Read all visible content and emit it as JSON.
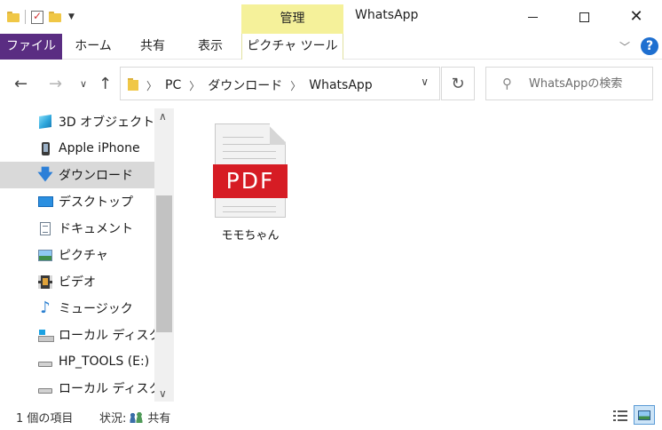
{
  "window": {
    "contextual_group": "管理",
    "title": "WhatsApp"
  },
  "ribbon": {
    "tabs": [
      {
        "label": "ファイル"
      },
      {
        "label": "ホーム"
      },
      {
        "label": "共有"
      },
      {
        "label": "表示"
      },
      {
        "label": "ピクチャ ツール"
      }
    ],
    "help_label": "?"
  },
  "address": {
    "crumbs": [
      "PC",
      "ダウンロード",
      "WhatsApp"
    ]
  },
  "search": {
    "placeholder": "WhatsAppの検索"
  },
  "sidebar": {
    "items": [
      {
        "label": "3D オブジェクト",
        "icon": "cube-3d-icon"
      },
      {
        "label": "Apple iPhone",
        "icon": "phone-icon"
      },
      {
        "label": "ダウンロード",
        "icon": "download-arrow-icon",
        "selected": true
      },
      {
        "label": "デスクトップ",
        "icon": "desktop-icon"
      },
      {
        "label": "ドキュメント",
        "icon": "document-icon"
      },
      {
        "label": "ピクチャ",
        "icon": "picture-icon"
      },
      {
        "label": "ビデオ",
        "icon": "video-icon"
      },
      {
        "label": "ミュージック",
        "icon": "music-note-icon"
      },
      {
        "label": "ローカル ディスク (C",
        "icon": "windows-drive-icon"
      },
      {
        "label": "HP_TOOLS (E:)",
        "icon": "drive-icon"
      },
      {
        "label": "ローカル ディスク (G",
        "icon": "drive-icon"
      }
    ]
  },
  "files": [
    {
      "name": "モモちゃん",
      "badge": "PDF",
      "icon": "pdf-file-icon"
    }
  ],
  "status": {
    "count": "1 個の項目",
    "state": "状況:",
    "state_value": "共有"
  },
  "colors": {
    "file_tab": "#5a2d82",
    "contextual_tab": "#f5f19a",
    "pdf_red": "#d61c24",
    "help": "#1e6fd0"
  }
}
